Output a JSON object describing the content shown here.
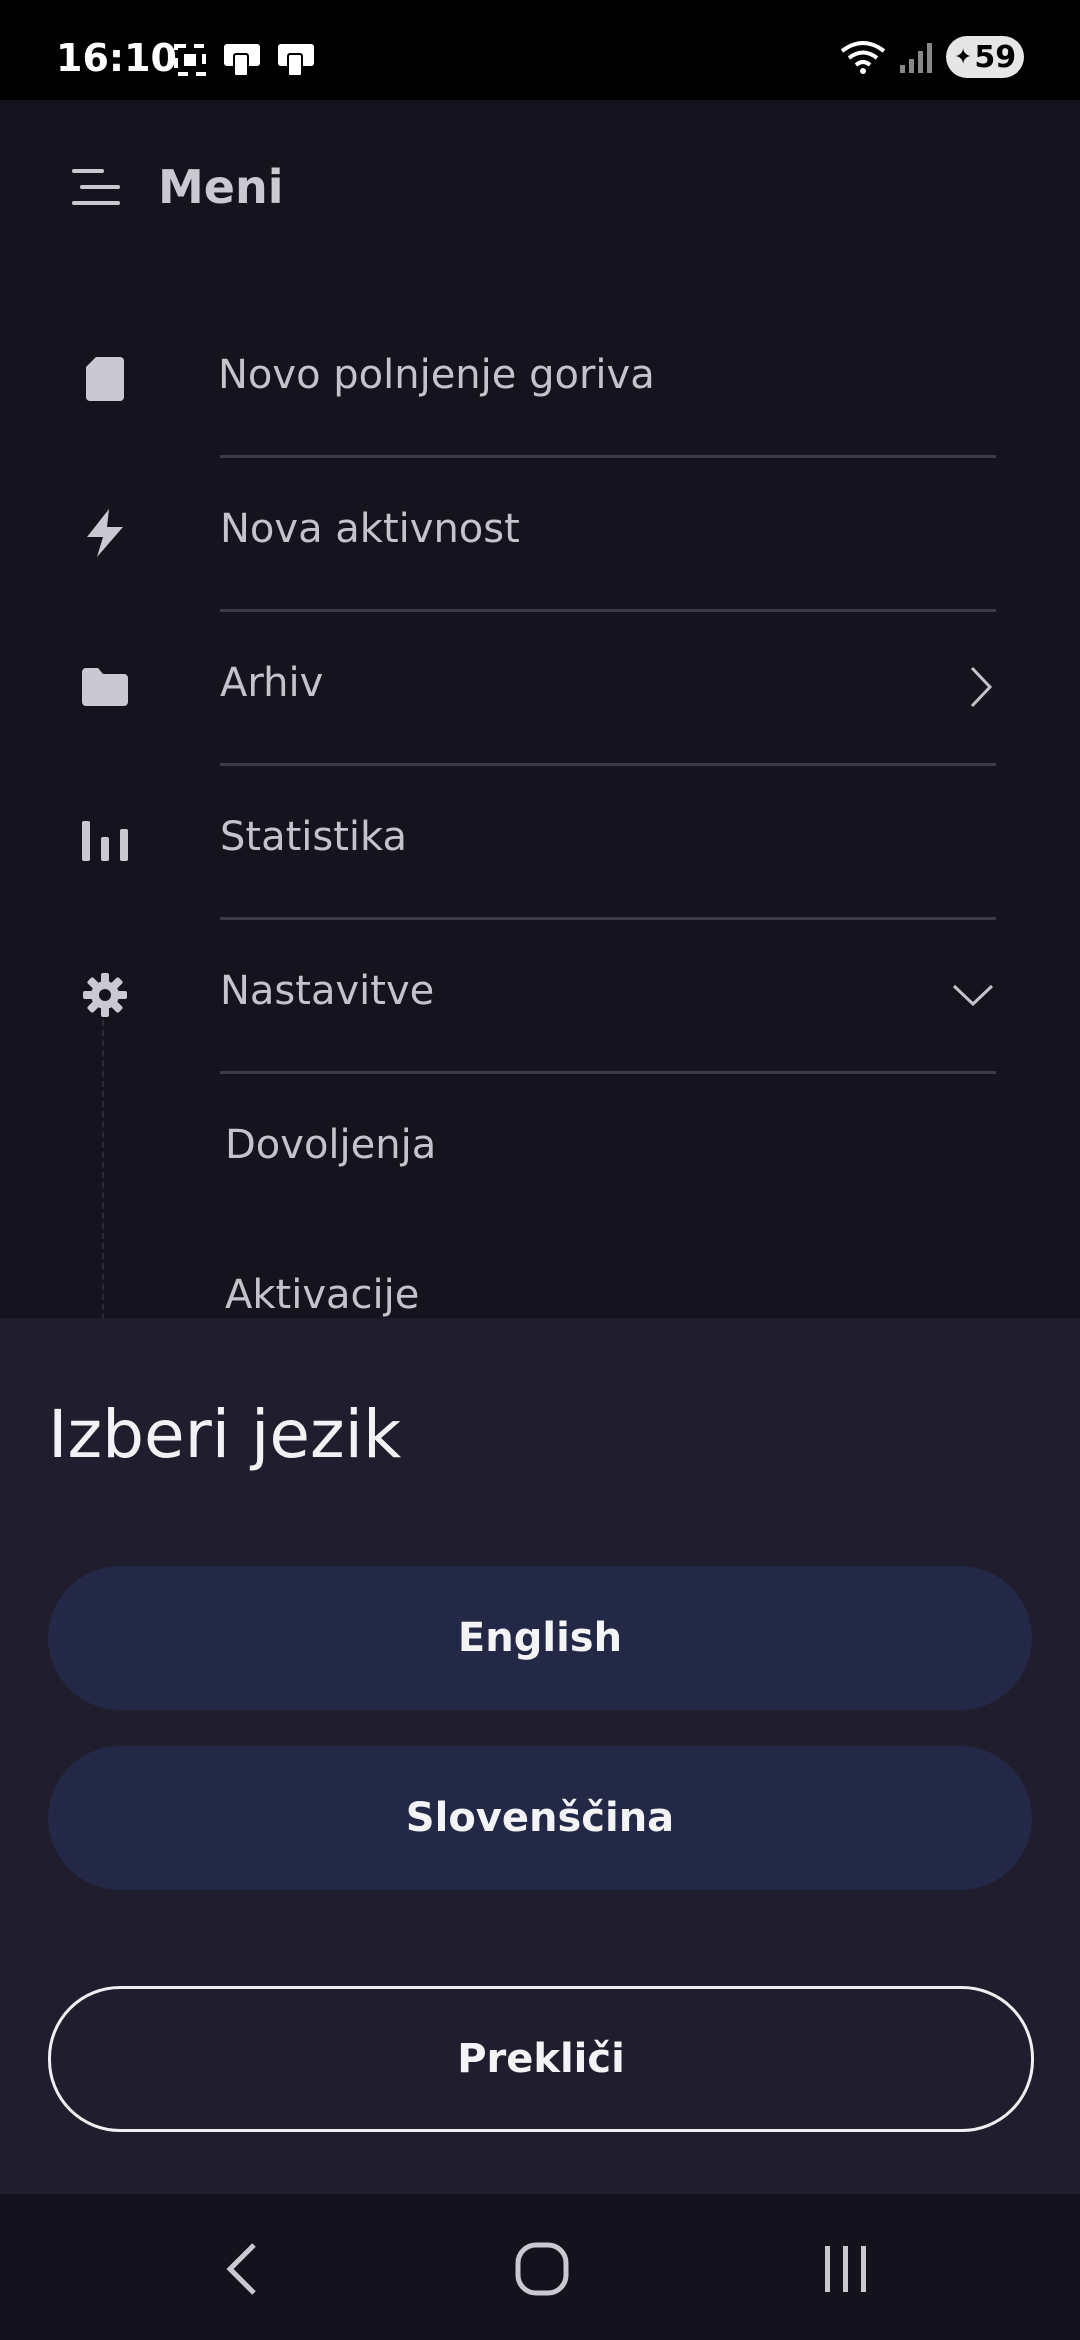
{
  "status_bar": {
    "time": "16:10",
    "battery": "59"
  },
  "drawer": {
    "title": "Meni",
    "items": [
      {
        "label": "Novo polnjenje goriva",
        "icon": "document-icon"
      },
      {
        "label": "Nova aktivnost",
        "icon": "lightning-icon"
      },
      {
        "label": "Arhiv",
        "icon": "folder-icon"
      },
      {
        "label": "Statistika",
        "icon": "bar-chart-icon"
      },
      {
        "label": "Nastavitve",
        "icon": "gear-icon"
      }
    ],
    "subitems": [
      {
        "label": "Dovoljenja"
      },
      {
        "label": "Aktivacije"
      }
    ]
  },
  "sheet": {
    "title": "Izberi jezik",
    "options": [
      {
        "label": "English"
      },
      {
        "label": "Slovenščina"
      }
    ],
    "cancel_label": "Prekliči"
  },
  "colors": {
    "background": "#15141e",
    "sheet": "#201e2e",
    "pill": "#222845"
  }
}
